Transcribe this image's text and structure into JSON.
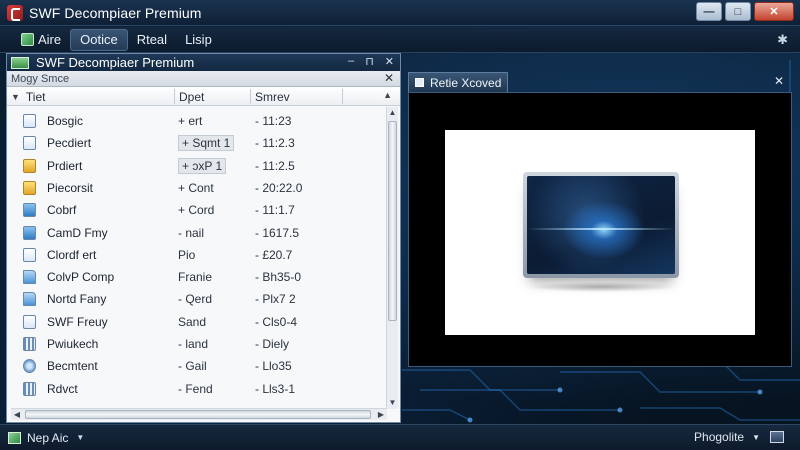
{
  "window": {
    "title": "SWF Decompiaer Premium",
    "controls": {
      "minimize": "—",
      "maximize": "□",
      "close": "✕"
    }
  },
  "menu": {
    "items": [
      {
        "label": "Aire",
        "icon": "app-menu-icon"
      },
      {
        "label": "Ootice"
      },
      {
        "label": "Rteal"
      },
      {
        "label": "Lisip"
      }
    ],
    "right_icon": "✱"
  },
  "left_panel": {
    "title": "SWF Decompiaer Premium",
    "header_controls": [
      "–",
      "⊓",
      "✕"
    ],
    "subheader": "Mogy Smce",
    "subheader_close": "✕",
    "columns": [
      "Tiet",
      "Dpet",
      "Smrev"
    ],
    "files": [
      {
        "name": "Bosgic",
        "date": "+ ert",
        "size": "- 11:23",
        "icon": "doc",
        "highlight": false
      },
      {
        "name": "Pecdiert",
        "date": "+ Sqmt 1",
        "size": "- 11:2.3",
        "icon": "doc",
        "highlight": true
      },
      {
        "name": "Prdiert",
        "date": "+ ɔxP 1",
        "size": "- 11:2.5",
        "icon": "yellow",
        "highlight": true
      },
      {
        "name": "Piecorsit",
        "date": "+ Cont",
        "size": "- 20:22.0",
        "icon": "yellow",
        "highlight": false
      },
      {
        "name": "Cobrf",
        "date": "+ Cord",
        "size": "- 11:1.7",
        "icon": "blue",
        "highlight": false
      },
      {
        "name": "CamD Fmy",
        "date": "- nail",
        "size": "- 1617.5",
        "icon": "blue",
        "highlight": false
      },
      {
        "name": "Clordf ert",
        "date": "Pio",
        "size": "- £20.7",
        "icon": "doc",
        "highlight": false
      },
      {
        "name": "ColvP Comp",
        "date": "Franie",
        "size": "- Bh35-0",
        "icon": "folder",
        "highlight": false
      },
      {
        "name": "Nortd Fany",
        "date": "- Qerd",
        "size": "- Plx7 2",
        "icon": "folder",
        "highlight": false
      },
      {
        "name": "SWF Freuy",
        "date": "Sand",
        "size": "- Cls0-4",
        "icon": "doc",
        "highlight": false
      },
      {
        "name": "Pwiukech",
        "date": "- land",
        "size": "- Diely",
        "icon": "grid",
        "highlight": false
      },
      {
        "name": "Becmtent",
        "date": "- Gail",
        "size": "- Llo35",
        "icon": "gear",
        "highlight": false
      },
      {
        "name": "Rdvct",
        "date": "- Fend",
        "size": "- Lls3-1",
        "icon": "grid",
        "highlight": false
      }
    ]
  },
  "right_panel": {
    "tab_label": "Retie Xcoved",
    "close": "✕"
  },
  "statusbar": {
    "left_label": "Nep Aic",
    "right_label": "Phogolite"
  }
}
